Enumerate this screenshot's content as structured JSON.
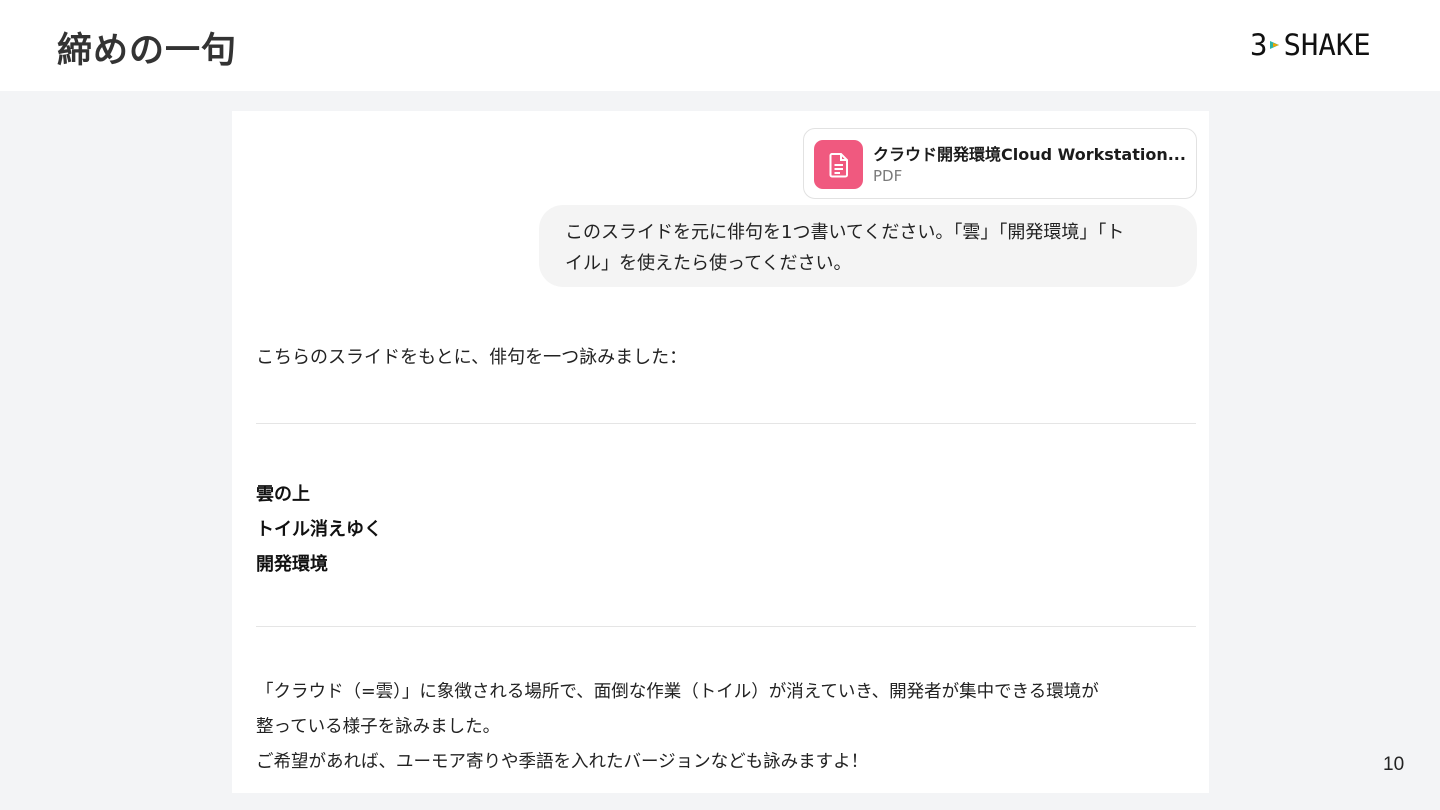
{
  "slide": {
    "title": "締めの一句",
    "logo_left": "3",
    "logo_right": "SHAKE",
    "page_number": "10"
  },
  "attachment": {
    "file_name": "クラウド開発環境Cloud Workstation...",
    "file_type": "PDF",
    "icon": "document-icon",
    "icon_color": "#f0597f"
  },
  "user_message": {
    "lines": [
      "このスライドを元に俳句を1つ書いてください。「雲」「開発環境」「ト",
      "イル」を使えたら使ってください。"
    ]
  },
  "assistant_message": {
    "intro": "こちらのスライドをもとに、俳句を一つ詠みました：",
    "haiku": [
      "雲の上",
      "トイル消えゆく",
      "開発環境"
    ],
    "explanation": [
      "「クラウド（=雲）」に象徴される場所で、面倒な作業（トイル）が消えていき、開発者が集中できる環境が",
      "整っている様子を詠みました。",
      "ご希望があれば、ユーモア寄りや季語を入れたバージョンなども詠みますよ！"
    ]
  }
}
